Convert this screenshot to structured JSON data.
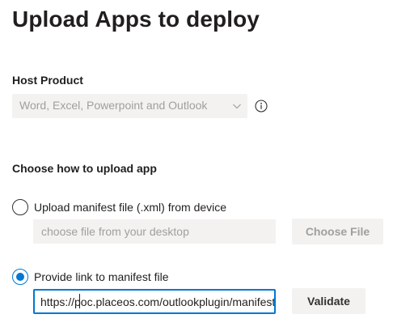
{
  "page": {
    "title": "Upload Apps to deploy"
  },
  "host_product": {
    "label": "Host Product",
    "selected_value": "Word, Excel, Powerpoint and Outlook",
    "info_icon": "info-icon",
    "chevron_icon": "chevron-down-icon"
  },
  "upload_method": {
    "label": "Choose how to upload app",
    "options": [
      {
        "label": "Upload manifest file (.xml) from device",
        "selected": false,
        "file_placeholder": "choose file from your desktop",
        "button_label": "Choose File"
      },
      {
        "label": "Provide link to manifest file",
        "selected": true,
        "url_value": "https://poc.placeos.com/outlookplugin/manifest.xml",
        "button_label": "Validate"
      }
    ]
  },
  "colors": {
    "accent": "#0078d4",
    "disabled_bg": "#f3f2f1",
    "disabled_text": "#a19f9d",
    "text": "#201f1e"
  }
}
